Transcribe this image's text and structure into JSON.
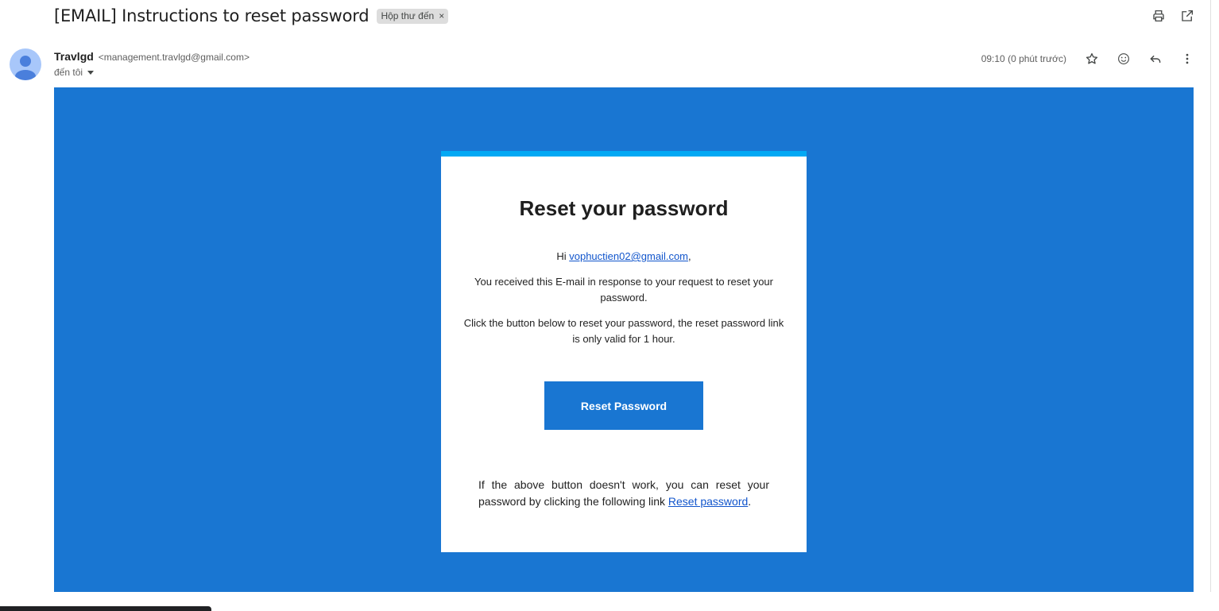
{
  "email": {
    "subject": "[EMAIL] Instructions to reset password",
    "label": "Hộp thư đến",
    "label_remove": "×",
    "sender_name": "Travlgd",
    "sender_email": "<management.travlgd@gmail.com>",
    "to_text": "đến tôi",
    "timestamp": "09:10 (0 phút trước)"
  },
  "icons": {
    "print": "print-icon",
    "open_new": "open-in-new-window-icon",
    "star": "star-icon",
    "emoji": "emoji-icon",
    "reply": "reply-icon",
    "more": "more-vert-icon"
  },
  "card": {
    "title": "Reset your password",
    "greeting_prefix": "Hi ",
    "recipient_link": "vophuctien02@gmail.com",
    "greeting_suffix": ",",
    "paragraph1": "You received this E-mail in response to your request to reset your password.",
    "paragraph2": "Click the button below to reset your password, the reset password link is only valid for 1 hour.",
    "button_label": "Reset Password",
    "fallback_text": "If the above button doesn't work, you can reset your password by clicking the following link ",
    "fallback_link": "Reset password",
    "fallback_end": "."
  },
  "colors": {
    "body_background": "#1976d2",
    "card_top_border": "#03a9f4",
    "button_background": "#1976d2",
    "link": "#1155cc",
    "avatar": "#a8c7fa"
  }
}
